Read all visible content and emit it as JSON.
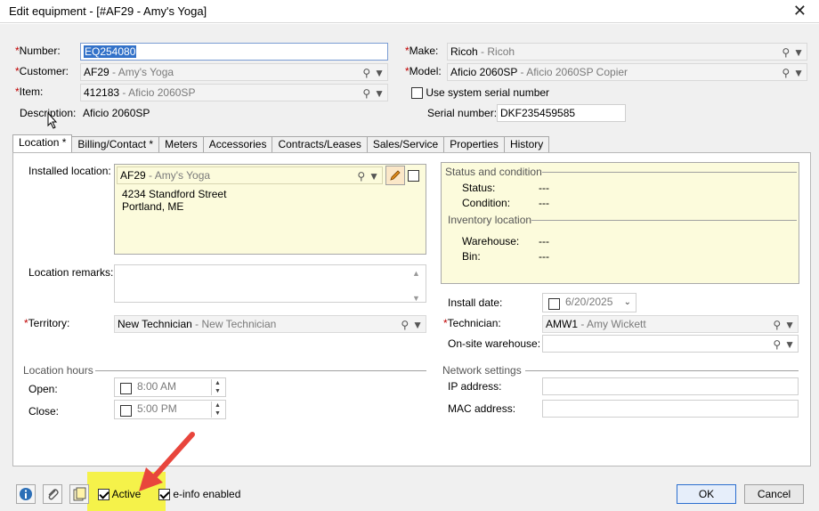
{
  "window": {
    "title": "Edit equipment - [#AF29 - Amy's Yoga]",
    "close_glyph": "✕"
  },
  "header": {
    "number": {
      "label": "Number:",
      "value": "EQ254080"
    },
    "customer": {
      "label": "Customer:",
      "id": "AF29",
      "name": "Amy's Yoga"
    },
    "item": {
      "label": "Item:",
      "id": "412183",
      "name": "Aficio 2060SP"
    },
    "description": {
      "label": "Description:",
      "value": "Aficio 2060SP"
    },
    "make": {
      "label": "Make:",
      "id": "Ricoh",
      "name": "Ricoh"
    },
    "model": {
      "label": "Model:",
      "id": "Aficio 2060SP",
      "name": "Aficio 2060SP Copier"
    },
    "use_system_serial": {
      "label": "Use system serial number",
      "checked": false
    },
    "serial_number": {
      "label": "Serial number:",
      "value": "DKF235459585"
    }
  },
  "tabs": [
    {
      "label": "Location *",
      "active": true
    },
    {
      "label": "Billing/Contact *",
      "active": false
    },
    {
      "label": "Meters",
      "active": false
    },
    {
      "label": "Accessories",
      "active": false
    },
    {
      "label": "Contracts/Leases",
      "active": false
    },
    {
      "label": "Sales/Service",
      "active": false
    },
    {
      "label": "Properties",
      "active": false
    },
    {
      "label": "History",
      "active": false
    }
  ],
  "location": {
    "installed_location": {
      "label": "Installed location:",
      "id": "AF29",
      "name": "Amy's Yoga",
      "address_line1": "4234 Standford Street",
      "address_line2": "Portland, ME"
    },
    "location_remarks": {
      "label": "Location remarks:",
      "value": ""
    },
    "territory": {
      "label": "Territory:",
      "id": "New Technician",
      "name": "New Technician"
    },
    "location_hours": {
      "title": "Location hours",
      "open": {
        "label": "Open:",
        "value": "8:00 AM"
      },
      "close": {
        "label": "Close:",
        "value": "5:00 PM"
      }
    },
    "status_condition": {
      "title": "Status and condition",
      "status": {
        "label": "Status:",
        "value": "---"
      },
      "condition": {
        "label": "Condition:",
        "value": "---"
      },
      "inventory_title": "Inventory location",
      "warehouse": {
        "label": "Warehouse:",
        "value": "---"
      },
      "bin": {
        "label": "Bin:",
        "value": "---"
      }
    },
    "install_date": {
      "label": "Install date:",
      "value": "6/20/2025"
    },
    "technician": {
      "label": "Technician:",
      "id": "AMW1",
      "name": "Amy Wickett"
    },
    "onsite_warehouse": {
      "label": "On-site warehouse:",
      "value": ""
    },
    "network": {
      "title": "Network settings",
      "ip": {
        "label": "IP address:",
        "value": ""
      },
      "mac": {
        "label": "MAC address:",
        "value": ""
      }
    }
  },
  "footer": {
    "active": {
      "label": "Active",
      "checked": true
    },
    "einfo": {
      "label": "e-info enabled",
      "checked": true
    },
    "ok_label": "OK",
    "cancel_label": "Cancel"
  },
  "colors": {
    "highlight": "#f5f24a",
    "arrow": "#e8453c",
    "required": "#c00000",
    "yellow_panel": "#fcfbdc"
  },
  "icons": [
    "search-icon",
    "dropdown-menu-icon",
    "pencil-icon",
    "info-icon",
    "paperclip-icon",
    "notes-icon",
    "calendar-icon",
    "close-icon"
  ]
}
